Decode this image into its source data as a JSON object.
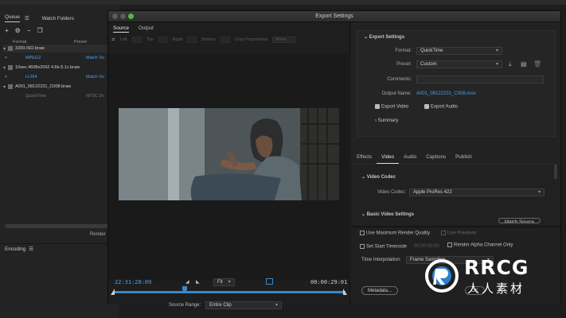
{
  "bg": {
    "tabs": [
      "Queue",
      "Watch Folders"
    ],
    "col_format": "Format",
    "col_preset": "Preset",
    "queue": [
      {
        "name": "3200-ISO.braw",
        "format": "MPEG2",
        "preset": "Match So"
      },
      {
        "name": "10sec.4608x2592 4.6k-5.1c.braw",
        "format": "H.264",
        "preset": "Match So"
      },
      {
        "name": "A001_08122231_C008.braw",
        "format": "QuickTime",
        "preset": "NTSC Dv"
      }
    ],
    "render_label": "Render",
    "encoding_label": "Encoding"
  },
  "dialog": {
    "title": "Export Settings",
    "left_tabs": [
      "Source",
      "Output"
    ],
    "crop": {
      "left": "Left",
      "top": "Top",
      "right": "Right",
      "bottom": "Bottom",
      "px": "px",
      "proportions_label": "Crop Proportions",
      "proportions_value": "None"
    },
    "timecode_current": "22:31:28:09",
    "timecode_total": "00:00:29:01",
    "zoom": "Fit",
    "source_range_label": "Source Range:",
    "source_range_value": "Entire Clip",
    "export_settings": {
      "heading": "Export Settings",
      "format_label": "Format:",
      "format_value": "QuickTime",
      "preset_label": "Preset:",
      "preset_value": "Custom",
      "comments_label": "Comments:",
      "output_label": "Output Name:",
      "output_value": "A001_08122231_C008.mov",
      "export_video": "Export Video",
      "export_audio": "Export Audio",
      "summary": "Summary"
    },
    "tabs": [
      "Effects",
      "Video",
      "Audio",
      "Captions",
      "Publish"
    ],
    "video_codec": {
      "heading": "Video Codec",
      "label": "Video Codec:",
      "value": "Apple ProRes 422"
    },
    "basic_video_heading": "Basic Video Settings",
    "match_source_btn": "Match Source",
    "lower": {
      "max_render": "Use Maximum Render Quality",
      "use_previews": "Use Previews",
      "set_start_tc": "Set Start Timecode",
      "start_tc_value": "00:00:00:00",
      "render_alpha": "Render Alpha Channel Only",
      "time_interp_label": "Time Interpolation:",
      "time_interp_value": "Frame Sampling",
      "metadata_btn": "Metadata...",
      "ok_btn": "OK"
    }
  },
  "watermark": {
    "brand": "RRCG",
    "sub": "人人素材"
  }
}
